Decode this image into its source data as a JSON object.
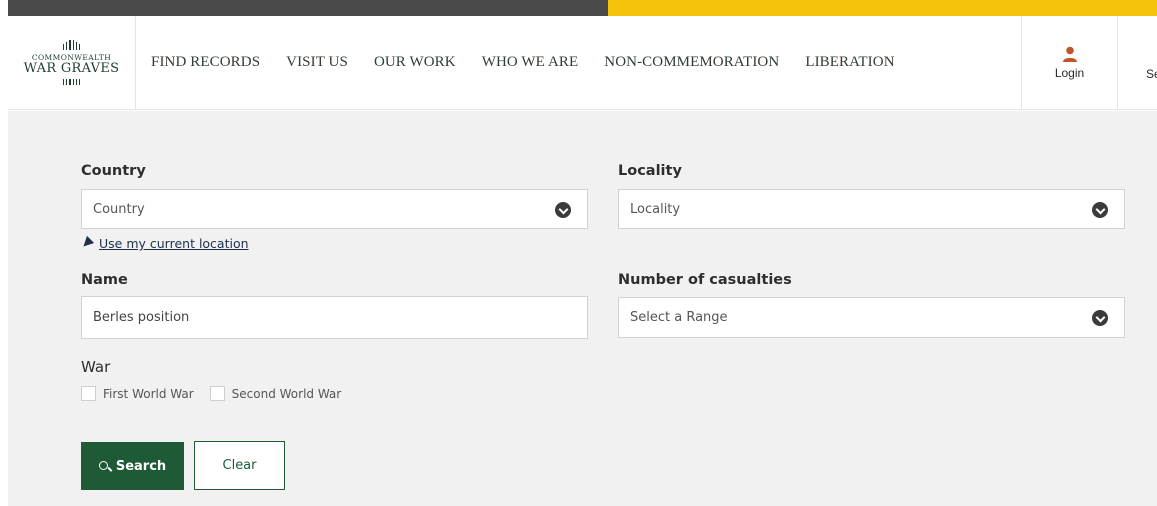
{
  "brand": {
    "line1": "COMMONWEALTH",
    "line2": "WAR GRAVES"
  },
  "nav": {
    "items": [
      {
        "label": "FIND RECORDS"
      },
      {
        "label": "VISIT US"
      },
      {
        "label": "OUR WORK"
      },
      {
        "label": "WHO WE ARE"
      },
      {
        "label": "NON-COMMEMORATION"
      },
      {
        "label": "LIBERATION"
      }
    ],
    "login_label": "Login",
    "search_label_partial": "Se"
  },
  "colors": {
    "stripe_dark": "#4a4a4a",
    "stripe_gold": "#f5c40a",
    "primary_green": "#1f5a36",
    "login_icon": "#c0552b"
  },
  "form": {
    "country": {
      "label": "Country",
      "placeholder": "Country"
    },
    "locality": {
      "label": "Locality",
      "placeholder": "Locality"
    },
    "use_location": "Use my current location",
    "name": {
      "label": "Name",
      "value": "Berles position"
    },
    "casualties": {
      "label": "Number of casualties",
      "placeholder": "Select a Range"
    },
    "war": {
      "label": "War",
      "options": [
        {
          "label": "First World War",
          "checked": false
        },
        {
          "label": "Second World War",
          "checked": false
        }
      ]
    },
    "search_button": "Search",
    "clear_button": "Clear"
  }
}
